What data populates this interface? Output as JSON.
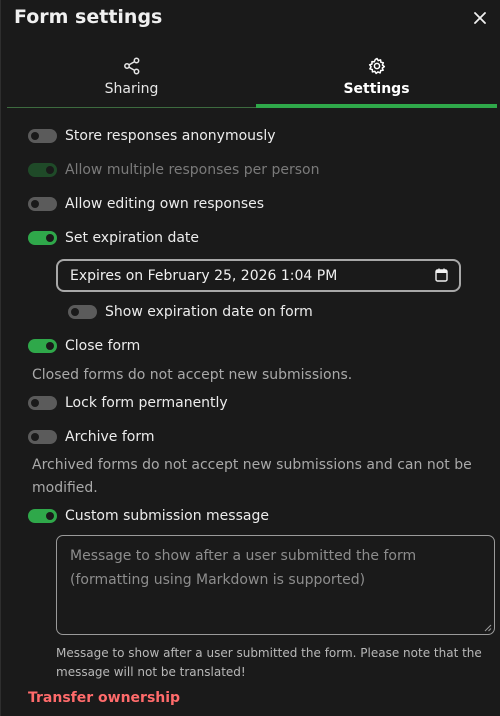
{
  "header": {
    "title": "Form settings",
    "close_icon": "close-icon"
  },
  "tabs": [
    {
      "label": "Sharing",
      "icon": "share-icon",
      "active": false
    },
    {
      "label": "Settings",
      "icon": "gear-icon",
      "active": true
    }
  ],
  "settings": {
    "anonymous": {
      "label": "Store responses anonymously",
      "on": false
    },
    "multiple": {
      "label": "Allow multiple responses per person",
      "on": true,
      "disabled": true
    },
    "editing": {
      "label": "Allow editing own responses",
      "on": false
    },
    "expiration": {
      "label": "Set expiration date",
      "on": true
    },
    "expiration_value": "Expires on February 25, 2026 1:04 PM",
    "show_expiration": {
      "label": "Show expiration date on form",
      "on": false
    },
    "close_form": {
      "label": "Close form",
      "on": true
    },
    "close_form_hint": "Closed forms do not accept new submissions.",
    "lock_form": {
      "label": "Lock form permanently",
      "on": false
    },
    "archive_form": {
      "label": "Archive form",
      "on": false
    },
    "archive_hint": "Archived forms do not accept new submissions and can not be modified.",
    "custom_message": {
      "label": "Custom submission message",
      "on": true
    },
    "message_placeholder": "Message to show after a user submitted the form\n(formatting using Markdown is supported)",
    "message_hint": "Message to show after a user submitted the form. Please note that the message will not be translated!"
  },
  "transfer_label": "Transfer ownership",
  "colors": {
    "accent": "#2fa84a",
    "danger": "#ff6b6b",
    "background": "#1a1a1a"
  }
}
